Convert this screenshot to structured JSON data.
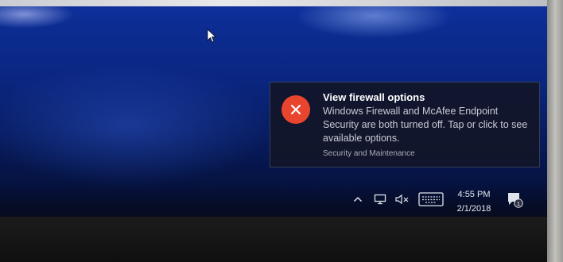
{
  "notification": {
    "title": "View firewall options",
    "body": "Windows Firewall and McAfee Endpoint Security are both turned off. Tap or click to see available options.",
    "source": "Security and Maintenance",
    "icon": "error-icon",
    "icon_color": "#e8442e"
  },
  "taskbar": {
    "clock_time": "4:55 PM",
    "clock_date": "2/1/2018",
    "tray_icons": [
      "chevron-up-icon",
      "network-icon",
      "speaker-muted-icon",
      "keyboard-icon",
      "action-center-icon"
    ],
    "notification_count": "1"
  },
  "colors": {
    "desktop_blue": "#0a2680",
    "toast_background": "#121628"
  }
}
